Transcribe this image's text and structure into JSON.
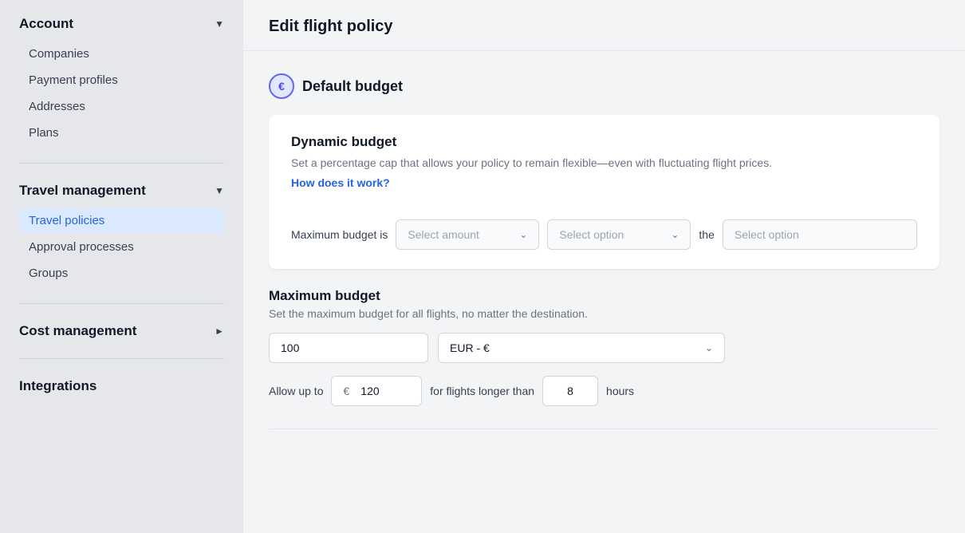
{
  "sidebar": {
    "account_section": {
      "title": "Account",
      "chevron": "▼",
      "items": [
        {
          "label": "Companies",
          "active": false
        },
        {
          "label": "Payment profiles",
          "active": false
        },
        {
          "label": "Addresses",
          "active": false
        },
        {
          "label": "Plans",
          "active": false
        }
      ]
    },
    "travel_section": {
      "title": "Travel management",
      "chevron": "▼",
      "items": [
        {
          "label": "Travel policies",
          "active": true
        },
        {
          "label": "Approval processes",
          "active": false
        },
        {
          "label": "Groups",
          "active": false
        }
      ]
    },
    "cost_section": {
      "title": "Cost management",
      "chevron": "►",
      "items": []
    },
    "integrations_section": {
      "title": "Integrations",
      "items": []
    }
  },
  "page": {
    "title": "Edit flight policy"
  },
  "default_budget": {
    "icon": "€",
    "title": "Default budget"
  },
  "dynamic_budget": {
    "title": "Dynamic budget",
    "description": "Set a percentage cap that allows your policy to remain flexible—even with fluctuating flight prices.",
    "link": "How does it work?",
    "row_label": "Maximum budget is",
    "select_amount_placeholder": "Select amount",
    "select_option_1_placeholder": "Select option",
    "the_label": "the",
    "select_option_2_placeholder": "Select option"
  },
  "maximum_budget": {
    "title": "Maximum budget",
    "description": "Set the maximum budget for all flights, no matter the destination.",
    "amount_value": "100",
    "currency_value": "EUR - €",
    "allow_label": "Allow up to",
    "euro_symbol": "€",
    "allow_amount": "120",
    "for_label": "for flights longer than",
    "hours_value": "8",
    "hours_label": "hours"
  }
}
